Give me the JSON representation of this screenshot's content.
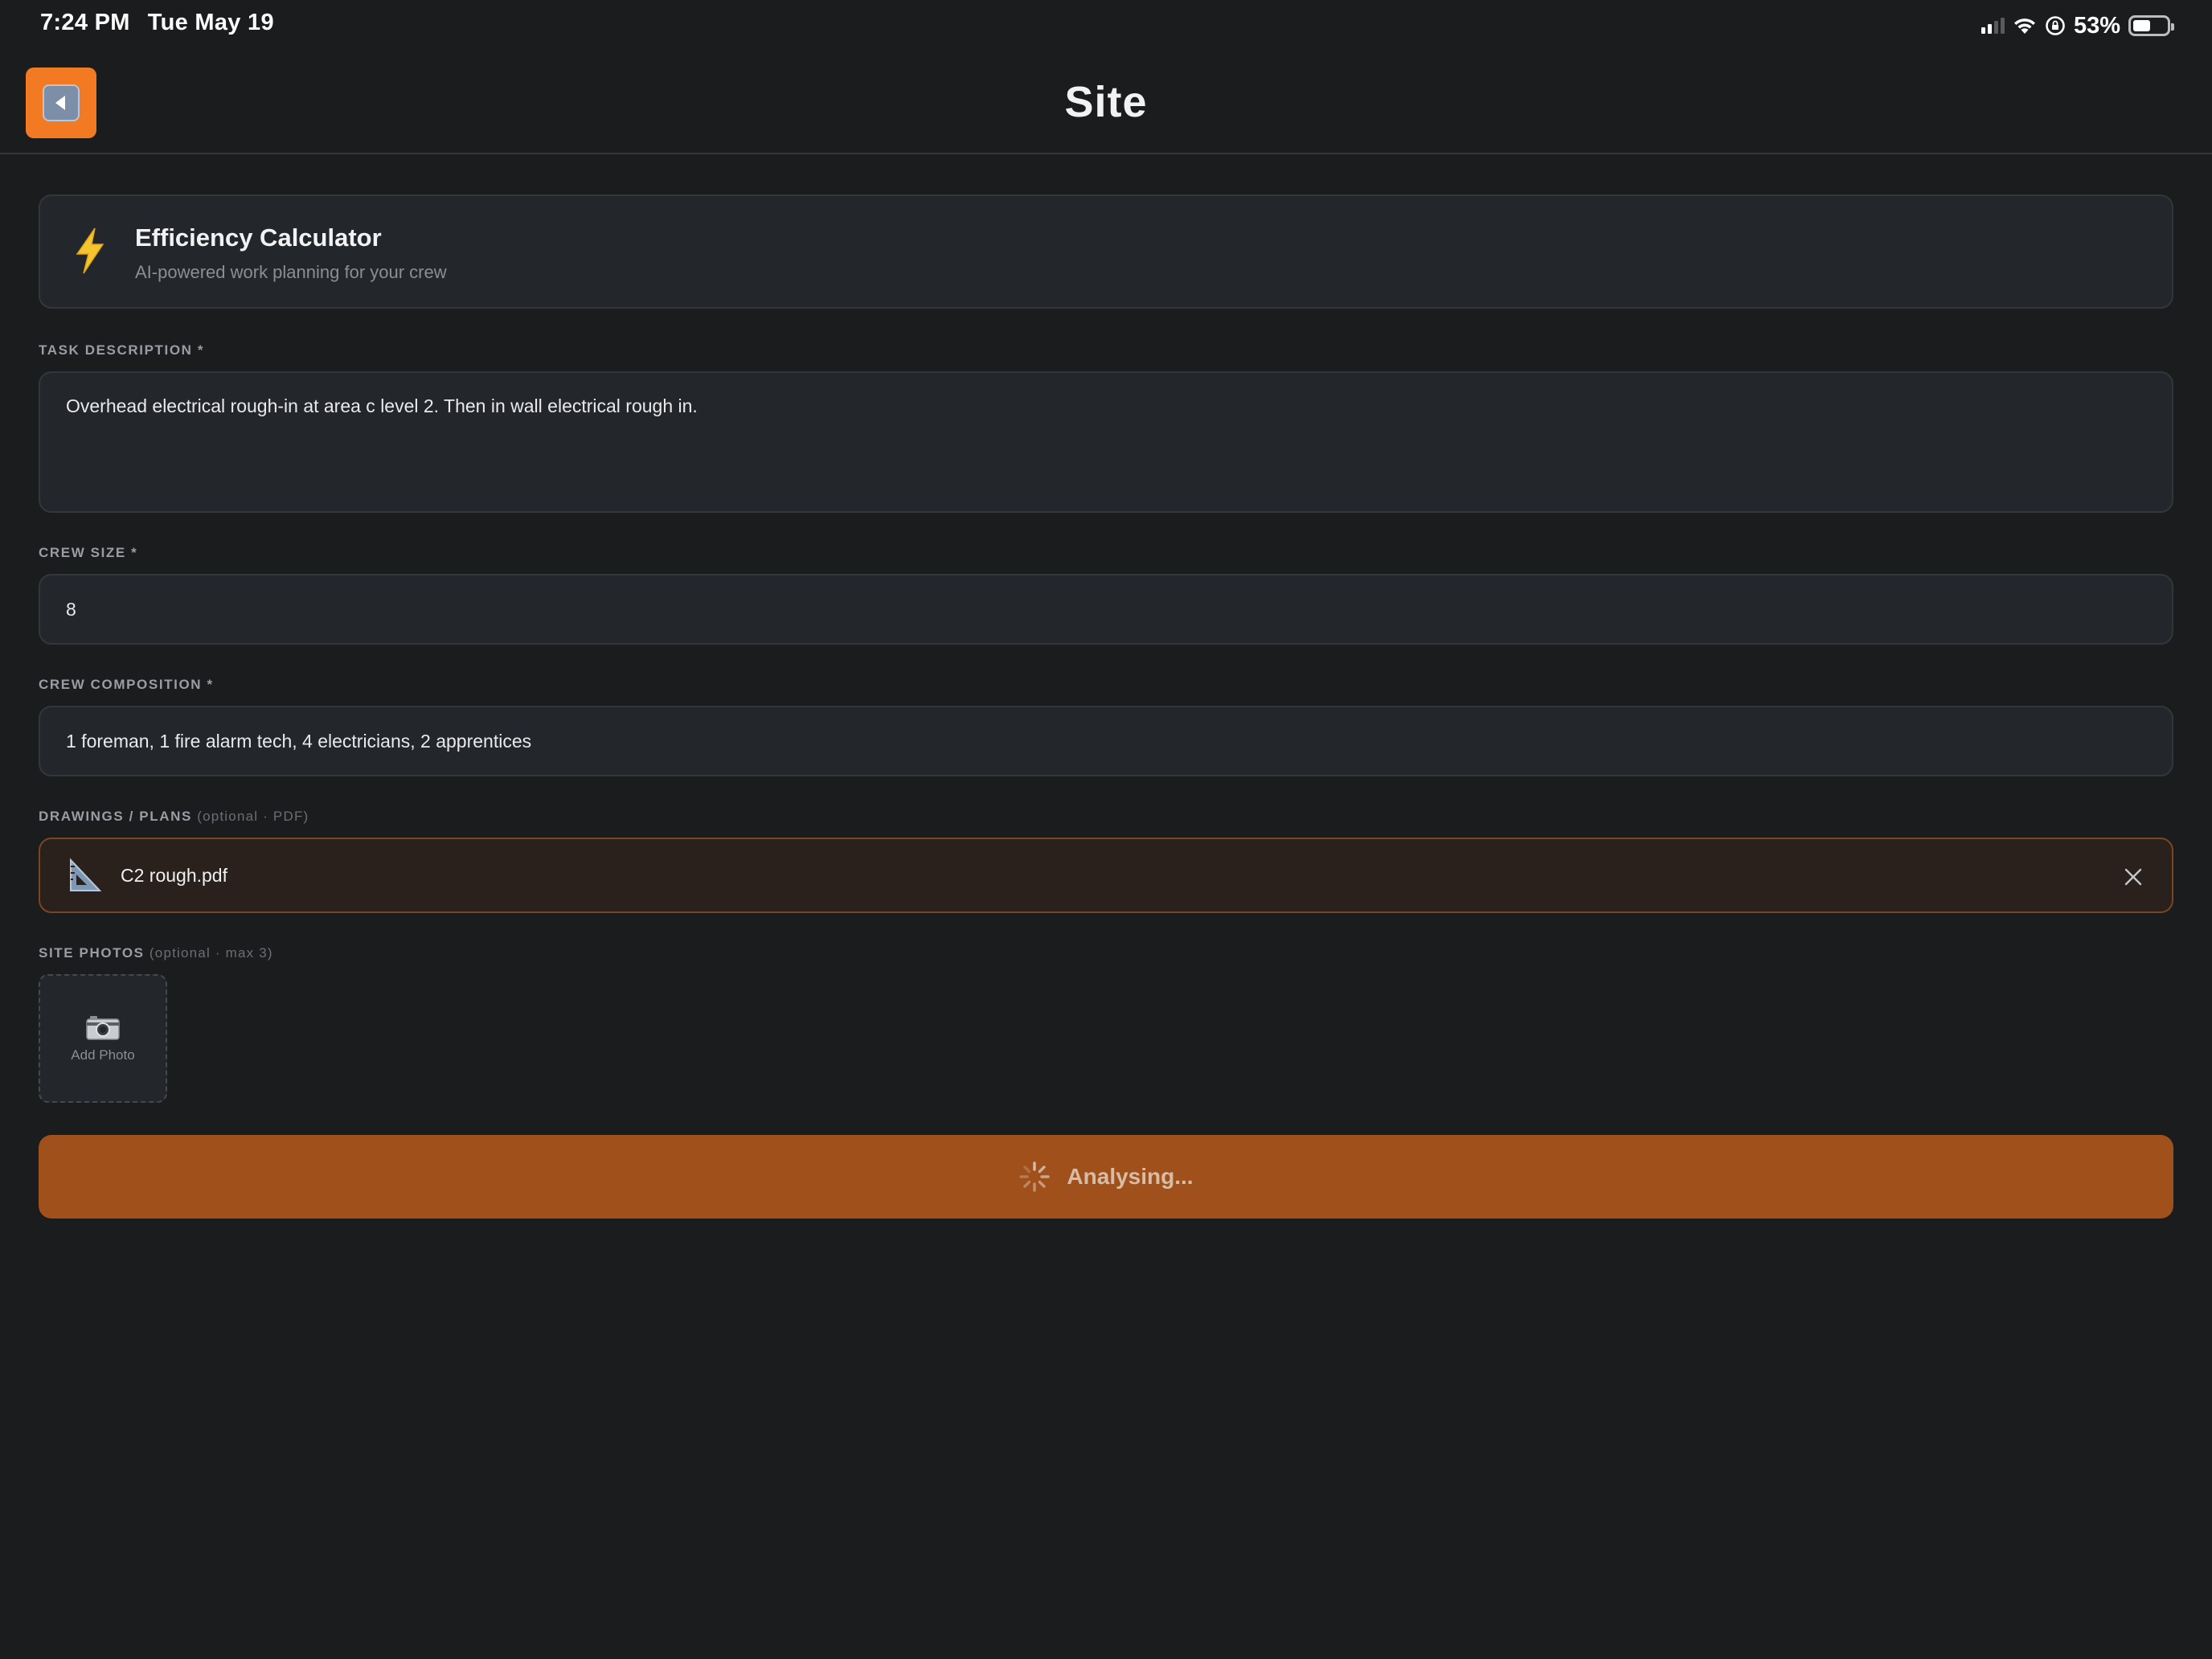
{
  "status_bar": {
    "time": "7:24 PM",
    "date": "Tue May 19",
    "battery_percent": "53%",
    "battery_level": 0.53,
    "signal_bars": 2,
    "icons": [
      "signal-icon",
      "wifi-icon",
      "orientation-lock-icon",
      "battery-icon"
    ]
  },
  "header": {
    "title": "Site",
    "back_icon": "back-arrow-icon",
    "accent_color": "#f27a22"
  },
  "hero": {
    "icon": "lightning-icon",
    "title": "Efficiency Calculator",
    "subtitle": "AI-powered work planning for your crew"
  },
  "form": {
    "task": {
      "label": "TASK DESCRIPTION *",
      "value": "Overhead electrical rough-in at area c level 2. Then in wall electrical rough in."
    },
    "crew_size": {
      "label": "CREW SIZE *",
      "value": "8"
    },
    "crew_composition": {
      "label": "CREW COMPOSITION *",
      "value": "1 foreman, 1 fire alarm tech, 4 electricians, 2 apprentices"
    },
    "drawings": {
      "label": "DRAWINGS / PLANS",
      "hint": "(optional · PDF)",
      "file_name": "C2 rough.pdf",
      "file_icon": "triangle-ruler-icon",
      "remove_icon": "close-icon"
    },
    "photos": {
      "label": "SITE PHOTOS",
      "hint": "(optional · max 3)",
      "add_label": "Add Photo",
      "add_icon": "camera-icon"
    },
    "submit": {
      "label": "Analysing...",
      "icon": "spinner-icon",
      "color": "#a0501b"
    }
  }
}
